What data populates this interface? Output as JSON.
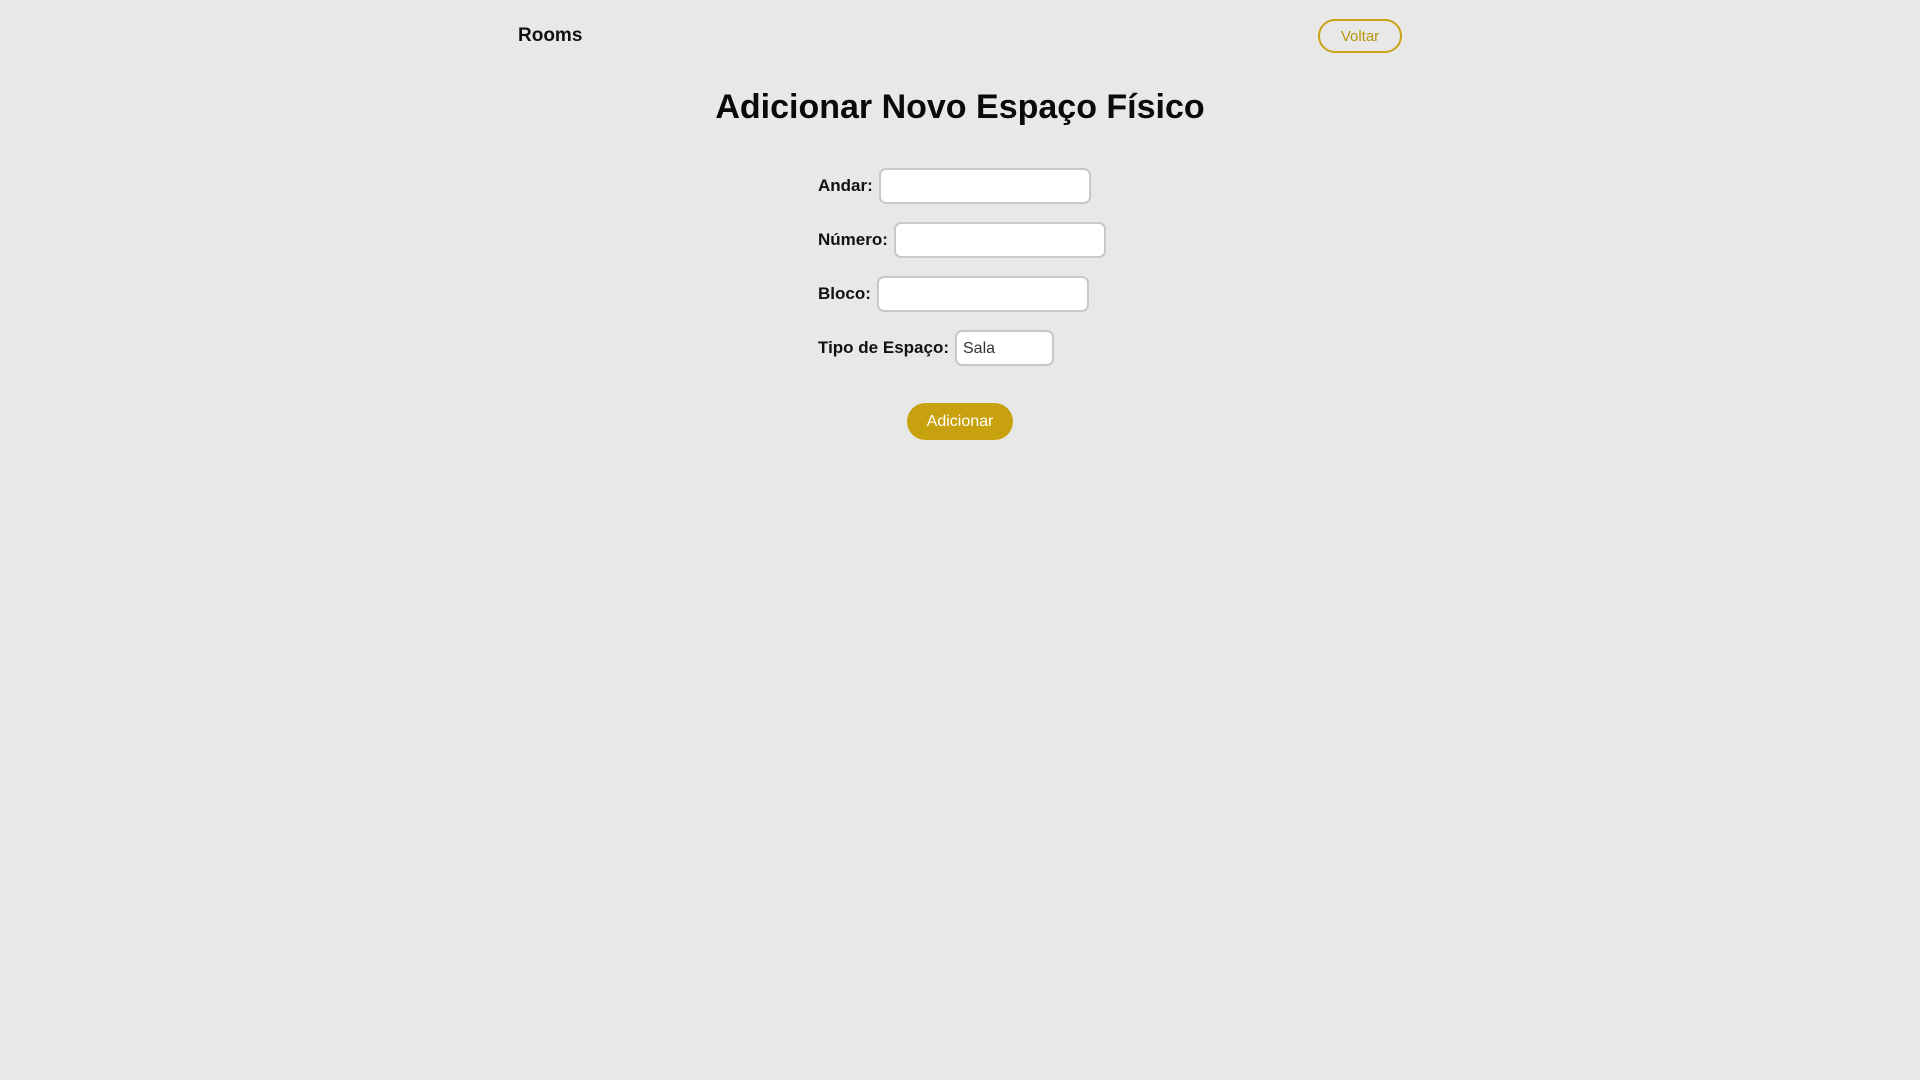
{
  "header": {
    "brand": "Rooms",
    "back_label": "Voltar"
  },
  "page": {
    "title": "Adicionar Novo Espaço Físico"
  },
  "form": {
    "andar": {
      "label": "Andar:",
      "value": "",
      "placeholder": ""
    },
    "numero": {
      "label": "Número:",
      "value": "",
      "placeholder": ""
    },
    "bloco": {
      "label": "Bloco:",
      "value": "",
      "placeholder": ""
    },
    "tipo": {
      "label": "Tipo de Espaço:",
      "selected": "Sala"
    },
    "submit_label": "Adicionar"
  },
  "colors": {
    "background": "#e8e8e8",
    "accent": "#c8a10e",
    "back_border": "#c9a414",
    "back_text": "#b8940f"
  }
}
